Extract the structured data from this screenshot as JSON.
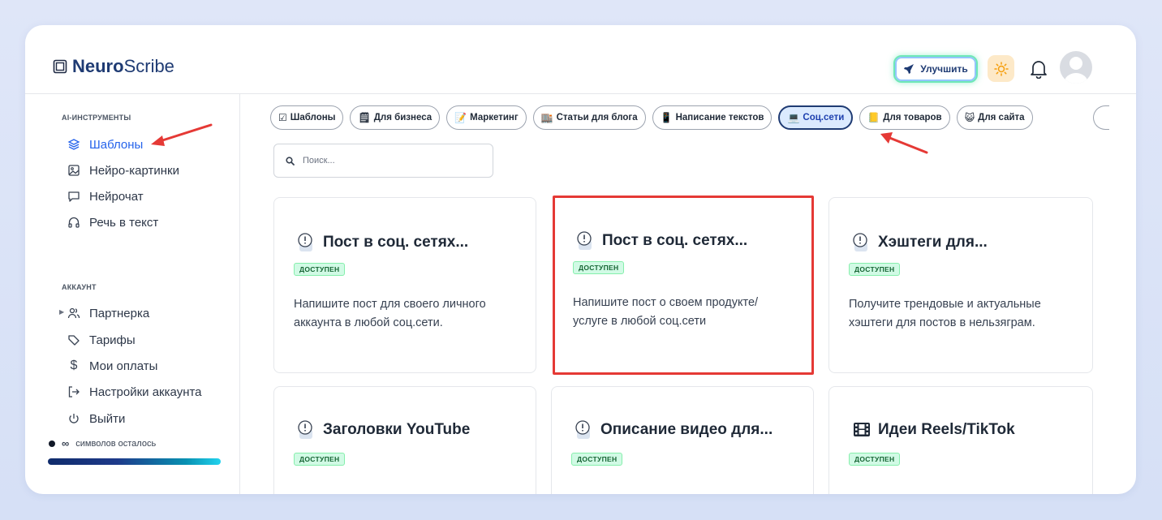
{
  "brand": {
    "name_bold": "Neuro",
    "name_light": "Scribe"
  },
  "header": {
    "upgrade_label": "Улучшить"
  },
  "sidebar": {
    "ai_tools_title": "AI-ИНСТРУМЕНТЫ",
    "ai_items": [
      {
        "label": "Шаблоны",
        "icon": "layers-icon",
        "active": true
      },
      {
        "label": "Нейро-картинки",
        "icon": "image-icon"
      },
      {
        "label": "Нейрочат",
        "icon": "chat-icon"
      },
      {
        "label": "Речь в текст",
        "icon": "headphones-icon"
      }
    ],
    "account_title": "АККАУНТ",
    "account_items": [
      {
        "label": "Партнерка",
        "icon": "users-icon"
      },
      {
        "label": "Тарифы",
        "icon": "tag-icon"
      },
      {
        "label": "Мои оплаты",
        "icon": "dollar-icon"
      },
      {
        "label": "Настройки аккаунта",
        "icon": "logout-arrow-icon"
      },
      {
        "label": "Выйти",
        "icon": "power-icon"
      }
    ],
    "symbols": {
      "infinity": "∞",
      "text": "символов осталось"
    }
  },
  "tabs": [
    {
      "emoji": "☑",
      "label": "Шаблоны"
    },
    {
      "emoji": "🗒",
      "label": "Для бизнеса"
    },
    {
      "emoji": "📝",
      "label": "Маркетинг"
    },
    {
      "emoji": "🏬",
      "label": "Статьи для блога"
    },
    {
      "emoji": "📱",
      "label": "Написание текстов"
    },
    {
      "emoji": "💻",
      "label": "Соц.сети",
      "active": true
    },
    {
      "emoji": "📒",
      "label": "Для товаров"
    },
    {
      "emoji": "😺",
      "label": "Для сайта"
    }
  ],
  "search": {
    "placeholder": "Поиск..."
  },
  "cards": [
    {
      "title": "Пост в соц. сетях...",
      "badge": "ДОСТУПЕН",
      "desc": "Напишите пост для своего личного аккаунта в любой соц.сети.",
      "icon": "alert-icon"
    },
    {
      "title": "Пост в соц. сетях...",
      "badge": "ДОСТУПЕН",
      "desc": "Напишите пост о своем продукте/ услуге в любой соц.сети",
      "icon": "alert-icon"
    },
    {
      "title": "Хэштеги для...",
      "badge": "ДОСТУПЕН",
      "desc": "Получите трендовые и актуальные хэштеги для постов в нельзяграм.",
      "icon": "alert-icon"
    },
    {
      "title": "Заголовки YouTube",
      "badge": "ДОСТУПЕН",
      "desc": "",
      "icon": "alert-icon"
    },
    {
      "title": "Описание видео для...",
      "badge": "ДОСТУПЕН",
      "desc": "",
      "icon": "alert-icon"
    },
    {
      "title": "Идеи Reels/TikTok",
      "badge": "ДОСТУПЕН",
      "desc": "",
      "icon": "film-icon"
    }
  ],
  "colors": {
    "accent": "#2563eb",
    "annotation_red": "#e53935",
    "badge_bg": "#d1fae5"
  }
}
